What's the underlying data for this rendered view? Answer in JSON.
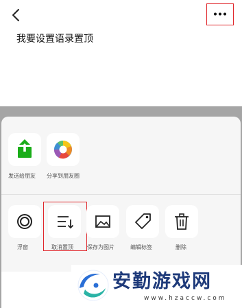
{
  "note": {
    "text": "我要设置语录置顶"
  },
  "share_row": [
    {
      "label": "发送给朋友",
      "icon": "share-to-friend-icon",
      "color": "#1aad19"
    },
    {
      "label": "分享到朋友圈",
      "icon": "moments-icon"
    }
  ],
  "action_row": [
    {
      "label": "浮窗",
      "icon": "float-window-icon"
    },
    {
      "label": "取消置顶",
      "icon": "unpin-icon"
    },
    {
      "label": "保存为图片",
      "icon": "image-icon"
    },
    {
      "label": "编辑标签",
      "icon": "tag-icon"
    },
    {
      "label": "删除",
      "icon": "trash-icon"
    }
  ],
  "watermark": {
    "title": "安勤游戏网",
    "url": "www.hzaccw.com"
  },
  "colors": {
    "highlight": "#e0262b",
    "share_green": "#1aad19",
    "watermark_blue": "#1e3a7a"
  }
}
